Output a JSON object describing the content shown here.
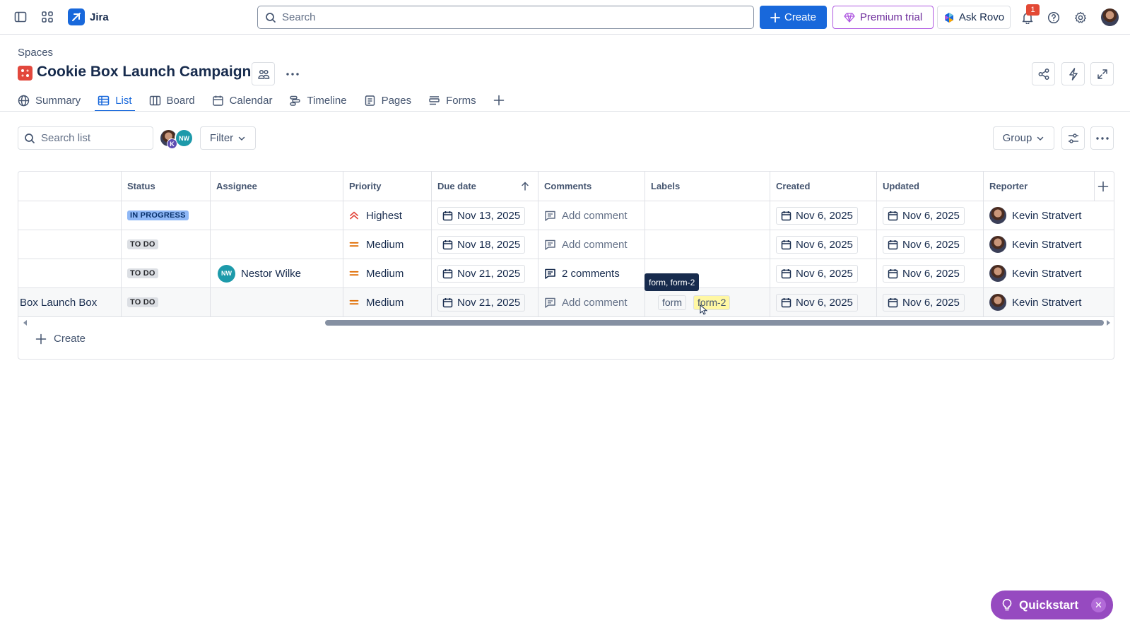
{
  "topnav": {
    "app_name": "Jira",
    "search_placeholder": "Search",
    "create_label": "Create",
    "premium_label": "Premium trial",
    "rovo_label": "Ask Rovo",
    "notification_count": "1"
  },
  "header": {
    "breadcrumb": "Spaces",
    "title": "Cookie Box Launch Campaign"
  },
  "tabs": [
    {
      "label": "Summary",
      "icon": "globe-icon"
    },
    {
      "label": "List",
      "icon": "list-icon",
      "active": true
    },
    {
      "label": "Board",
      "icon": "board-icon"
    },
    {
      "label": "Calendar",
      "icon": "calendar-icon"
    },
    {
      "label": "Timeline",
      "icon": "timeline-icon"
    },
    {
      "label": "Pages",
      "icon": "pages-icon"
    },
    {
      "label": "Forms",
      "icon": "forms-icon"
    }
  ],
  "toolbar": {
    "search_placeholder": "Search list",
    "avatar_initials_1": "K",
    "avatar_initials_2": "NW",
    "filter_label": "Filter",
    "group_label": "Group"
  },
  "table": {
    "columns": [
      "Status",
      "Assignee",
      "Priority",
      "Due date",
      "Comments",
      "Labels",
      "Created",
      "Updated",
      "Reporter"
    ],
    "rows": [
      {
        "summary": "",
        "status": "IN PROGRESS",
        "assignee": "",
        "assignee_initials": "",
        "priority": "Highest",
        "due": "Nov 13, 2025",
        "comments": "Add comment",
        "labels": [],
        "created": "Nov 6, 2025",
        "updated": "Nov 6, 2025",
        "reporter": "Kevin Stratvert"
      },
      {
        "summary": "",
        "status": "TO DO",
        "assignee": "",
        "assignee_initials": "",
        "priority": "Medium",
        "due": "Nov 18, 2025",
        "comments": "Add comment",
        "labels": [],
        "created": "Nov 6, 2025",
        "updated": "Nov 6, 2025",
        "reporter": "Kevin Stratvert"
      },
      {
        "summary": "",
        "status": "TO DO",
        "assignee": "Nestor Wilke",
        "assignee_initials": "NW",
        "priority": "Medium",
        "due": "Nov 21, 2025",
        "comments": "2 comments",
        "labels": [],
        "created": "Nov 6, 2025",
        "updated": "Nov 6, 2025",
        "reporter": "Kevin Stratvert"
      },
      {
        "summary": "Box Launch Box",
        "status": "TO DO",
        "assignee": "",
        "assignee_initials": "",
        "priority": "Medium",
        "due": "Nov 21, 2025",
        "comments": "Add comment",
        "labels": [
          "form",
          "form-2"
        ],
        "created": "Nov 6, 2025",
        "updated": "Nov 6, 2025",
        "reporter": "Kevin Stratvert"
      }
    ],
    "create_label": "Create",
    "tooltip": "form, form-2"
  },
  "quickstart": {
    "label": "Quickstart"
  },
  "colors": {
    "accent": "#1868db",
    "premium": "#af59e1",
    "quickstart": "#964ac0",
    "highest": "#e2483d",
    "medium": "#e06c00"
  }
}
